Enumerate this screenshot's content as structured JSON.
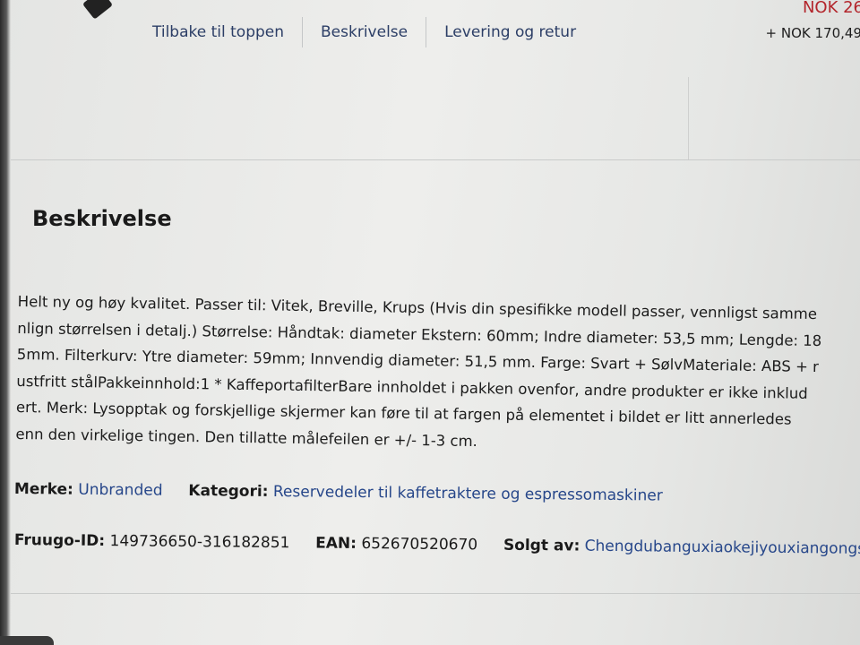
{
  "nav": {
    "items": [
      "Tilbake til toppen",
      "Beskrivelse",
      "Levering og retur"
    ]
  },
  "price": {
    "main": "NOK 26",
    "shipping": "+ NOK 170,49"
  },
  "section": {
    "heading": "Beskrivelse"
  },
  "description": {
    "lines": [
      "Helt ny og høy kvalitet. Passer til: Vitek, Breville, Krups (Hvis din spesifikke modell passer, vennligst samme",
      "nlign størrelsen i detalj.) Størrelse: Håndtak: diameter Ekstern: 60mm; Indre diameter: 53,5 mm; Lengde: 18",
      "5mm. Filterkurv: Ytre diameter: 59mm; Innvendig diameter: 51,5 mm. Farge: Svart + SølvMateriale: ABS + r",
      "ustfritt stålPakkeinnhold:1 * KaffeportafilterBare innholdet i pakken ovenfor, andre produkter er ikke inklud",
      "ert. Merk: Lysopptak og forskjellige skjermer kan føre til at fargen på elementet i bildet er litt annerledes",
      "enn den virkelige tingen. Den tillatte målefeilen er +/- 1-3 cm."
    ]
  },
  "meta": {
    "brand_label": "Merke:",
    "brand_value": "Unbranded",
    "category_label": "Kategori:",
    "category_value": "Reservedeler til kaffetraktere og espressomaskiner",
    "fruugo_label": "Fruugo-ID:",
    "fruugo_value": "149736650-316182851",
    "ean_label": "EAN:",
    "ean_value": "652670520670",
    "seller_label": "Solgt av:",
    "seller_value": "Chengdubanguxiaokejiyouxiangongsi"
  },
  "colors": {
    "link": "#27478a",
    "price": "#b3262c",
    "nav": "#2c3e66"
  }
}
